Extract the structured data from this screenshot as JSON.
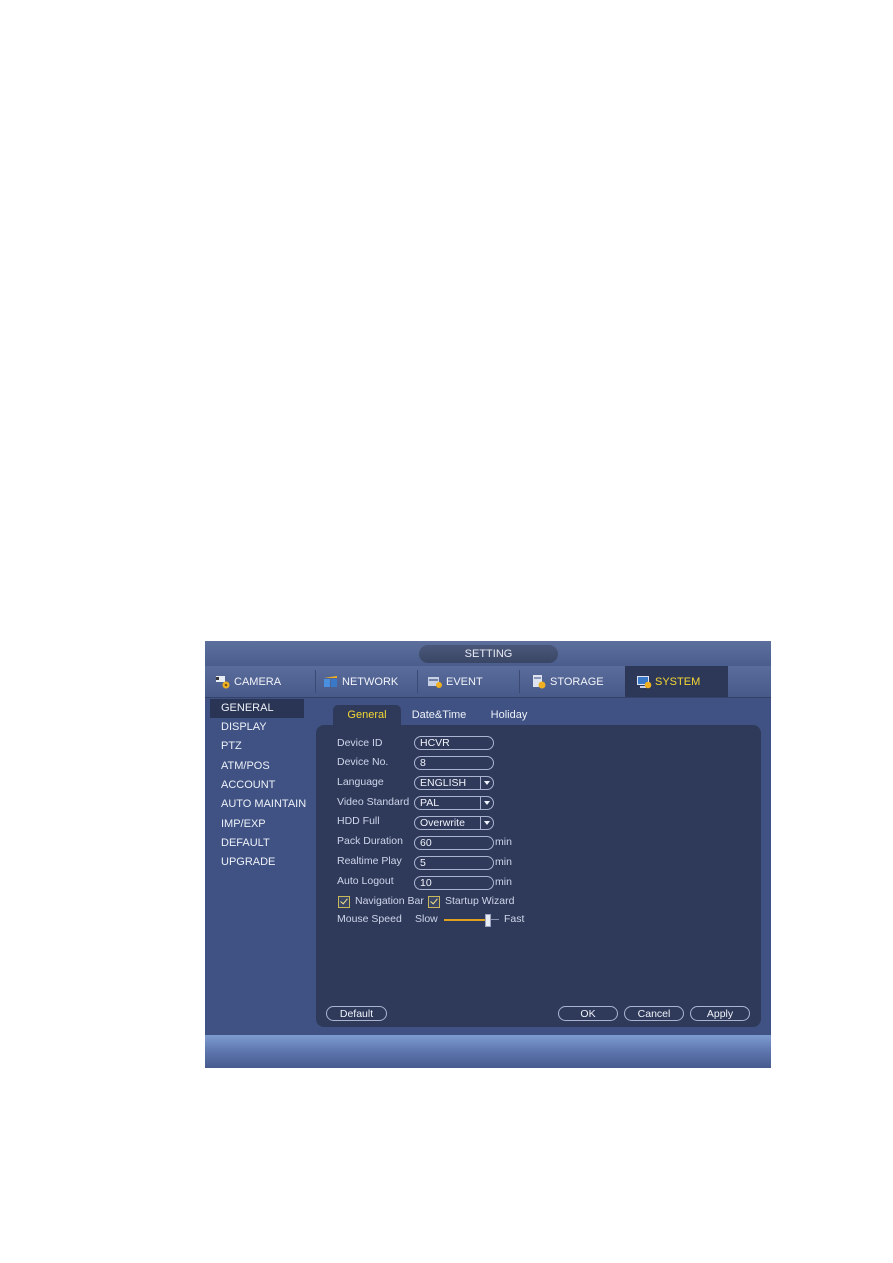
{
  "window": {
    "title": "SETTING"
  },
  "main_tabs": [
    {
      "label": "CAMERA",
      "icon": "camera-settings-icon",
      "active": false
    },
    {
      "label": "NETWORK",
      "icon": "network-icon",
      "active": false
    },
    {
      "label": "EVENT",
      "icon": "event-icon",
      "active": false
    },
    {
      "label": "STORAGE",
      "icon": "storage-icon",
      "active": false
    },
    {
      "label": "SYSTEM",
      "icon": "system-icon",
      "active": true
    }
  ],
  "sidebar": {
    "items": [
      {
        "label": "GENERAL",
        "active": true
      },
      {
        "label": "DISPLAY"
      },
      {
        "label": "PTZ"
      },
      {
        "label": "ATM/POS"
      },
      {
        "label": "ACCOUNT"
      },
      {
        "label": "AUTO MAINTAIN"
      },
      {
        "label": "IMP/EXP"
      },
      {
        "label": "DEFAULT"
      },
      {
        "label": "UPGRADE"
      }
    ]
  },
  "sub_tabs": [
    {
      "label": "General",
      "active": true
    },
    {
      "label": "Date&Time"
    },
    {
      "label": "Holiday"
    }
  ],
  "form": {
    "device_id": {
      "label": "Device ID",
      "value": "HCVR"
    },
    "device_no": {
      "label": "Device No.",
      "value": "8"
    },
    "language": {
      "label": "Language",
      "value": "ENGLISH"
    },
    "video_standard": {
      "label": "Video Standard",
      "value": "PAL"
    },
    "hdd_full": {
      "label": "HDD Full",
      "value": "Overwrite"
    },
    "pack_duration": {
      "label": "Pack Duration",
      "value": "60",
      "unit": "min"
    },
    "realtime_play": {
      "label": "Realtime Play",
      "value": "5",
      "unit": "min"
    },
    "auto_logout": {
      "label": "Auto Logout",
      "value": "10",
      "unit": "min"
    },
    "navigation_bar": {
      "label": "Navigation Bar",
      "checked": true
    },
    "startup_wizard": {
      "label": "Startup Wizard",
      "checked": true
    },
    "mouse_speed": {
      "label": "Mouse Speed",
      "min_label": "Slow",
      "max_label": "Fast",
      "value_fraction": 0.8
    }
  },
  "buttons": {
    "default": "Default",
    "ok": "OK",
    "cancel": "Cancel",
    "apply": "Apply"
  },
  "colors": {
    "active_text": "#f5d832",
    "slider_track": "#e0a020"
  }
}
